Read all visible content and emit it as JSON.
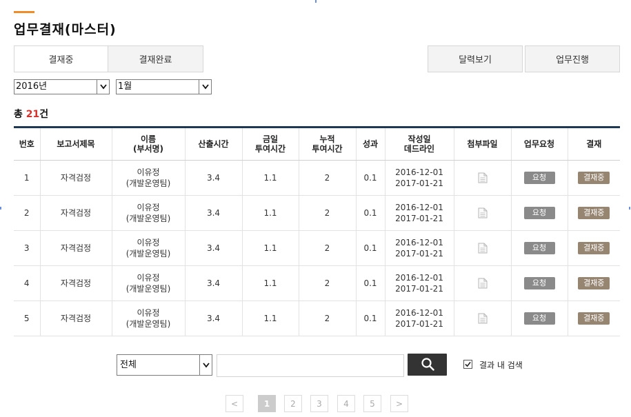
{
  "page": {
    "title": "업무결재(마스터)"
  },
  "tabs": [
    {
      "label": "결재중",
      "active": true
    },
    {
      "label": "결재완료",
      "active": false
    }
  ],
  "actions": {
    "calendar_label": "달력보기",
    "progress_label": "업무진행"
  },
  "filters": {
    "year": "2016년",
    "month": "1월"
  },
  "summary": {
    "prefix": "총 ",
    "count": "21",
    "suffix": "건"
  },
  "table": {
    "headers": [
      {
        "line1": "번호",
        "line2": ""
      },
      {
        "line1": "보고서제목",
        "line2": ""
      },
      {
        "line1": "이름",
        "line2": "(부서명)"
      },
      {
        "line1": "산출시간",
        "line2": ""
      },
      {
        "line1": "금일",
        "line2": "투여시간"
      },
      {
        "line1": "누적",
        "line2": "투여시간"
      },
      {
        "line1": "성과",
        "line2": ""
      },
      {
        "line1": "작성일",
        "line2": "데드라인"
      },
      {
        "line1": "첨부파일",
        "line2": ""
      },
      {
        "line1": "업무요청",
        "line2": ""
      },
      {
        "line1": "결재",
        "line2": ""
      }
    ],
    "rows": [
      {
        "no": "1",
        "title": "자격검정",
        "name": "이유정",
        "dept": "(개발운영팀)",
        "calc": "3.4",
        "today": "1.1",
        "total": "2",
        "perf": "0.1",
        "created": "2016-12-01",
        "deadline": "2017-01-21",
        "request": "요청",
        "status": "결재중"
      },
      {
        "no": "2",
        "title": "자격검정",
        "name": "이유정",
        "dept": "(개발운영팀)",
        "calc": "3.4",
        "today": "1.1",
        "total": "2",
        "perf": "0.1",
        "created": "2016-12-01",
        "deadline": "2017-01-21",
        "request": "요청",
        "status": "결재중"
      },
      {
        "no": "3",
        "title": "자격검정",
        "name": "이유정",
        "dept": "(개발운영팀)",
        "calc": "3.4",
        "today": "1.1",
        "total": "2",
        "perf": "0.1",
        "created": "2016-12-01",
        "deadline": "2017-01-21",
        "request": "요청",
        "status": "결재중"
      },
      {
        "no": "4",
        "title": "자격검정",
        "name": "이유정",
        "dept": "(개발운영팀)",
        "calc": "3.4",
        "today": "1.1",
        "total": "2",
        "perf": "0.1",
        "created": "2016-12-01",
        "deadline": "2017-01-21",
        "request": "요청",
        "status": "결재중"
      },
      {
        "no": "5",
        "title": "자격검정",
        "name": "이유정",
        "dept": "(개발운영팀)",
        "calc": "3.4",
        "today": "1.1",
        "total": "2",
        "perf": "0.1",
        "created": "2016-12-01",
        "deadline": "2017-01-21",
        "request": "요청",
        "status": "결재중"
      }
    ]
  },
  "search": {
    "scope": "전체",
    "value": "",
    "within_label": "결과 내 검색",
    "within_checked": true
  },
  "pagination": {
    "prev": "<",
    "pages": [
      "1",
      "2",
      "3",
      "4",
      "5"
    ],
    "current": "1",
    "next": ">"
  },
  "colors": {
    "accent": "#f08c28",
    "table_top_border": "#1e3853",
    "count_highlight": "#d4322c",
    "status_badge": "#968571",
    "request_badge": "#8a8a8a",
    "search_button": "#333333"
  },
  "icons": {
    "attachment": "document-icon",
    "search": "search-icon",
    "dropdown": "chevron-down-icon",
    "checkbox": "check-icon"
  }
}
